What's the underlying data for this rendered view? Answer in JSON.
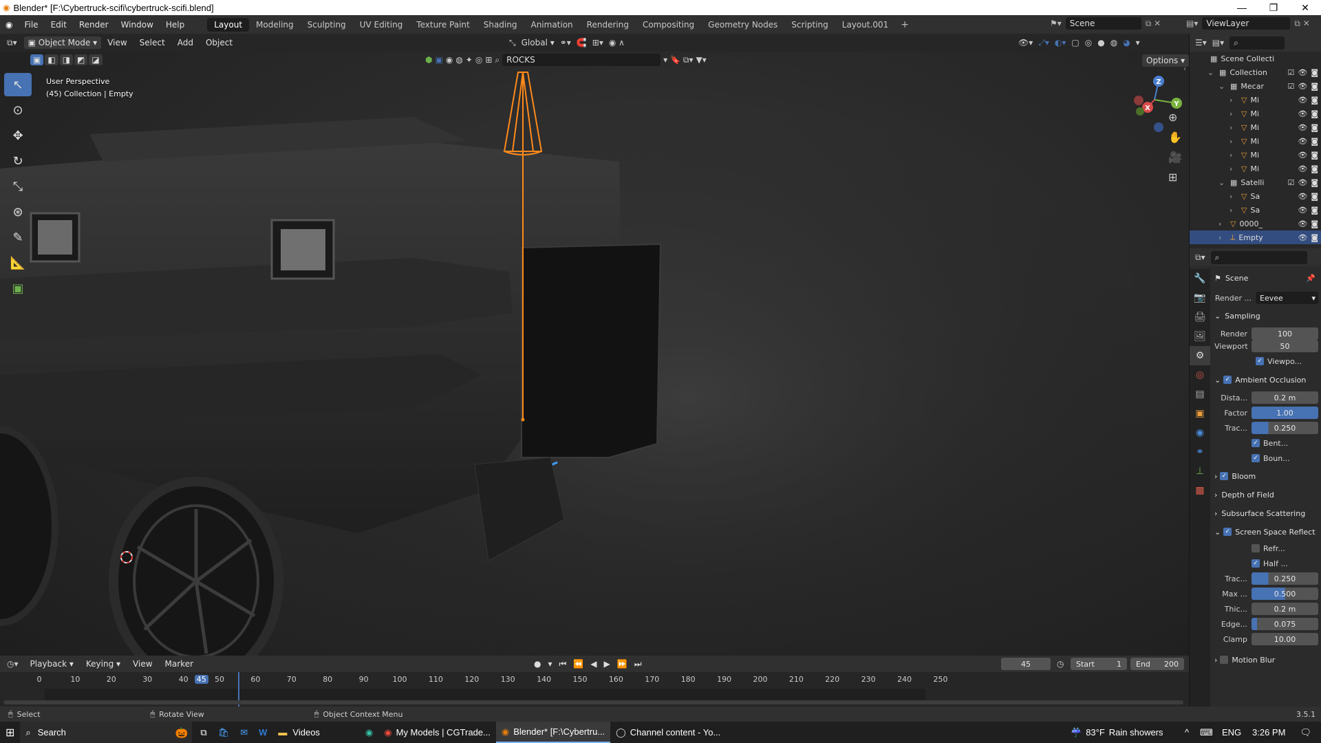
{
  "window": {
    "title": "Blender* [F:\\Cybertruck-scifi\\cybertruck-scifi.blend]"
  },
  "menu": [
    "File",
    "Edit",
    "Render",
    "Window",
    "Help"
  ],
  "workspaces": [
    "Layout",
    "Modeling",
    "Sculpting",
    "UV Editing",
    "Texture Paint",
    "Shading",
    "Animation",
    "Rendering",
    "Compositing",
    "Geometry Nodes",
    "Scripting",
    "Layout.001"
  ],
  "active_workspace": "Layout",
  "scene": {
    "label": "Scene",
    "view_layer": "ViewLayer"
  },
  "viewport_header": {
    "mode": "Object Mode",
    "menus": [
      "View",
      "Select",
      "Add",
      "Object"
    ],
    "orientation": "Global",
    "collection_filter": "ROCKS",
    "options": "Options"
  },
  "viewport": {
    "overlay_line1": "User Perspective",
    "overlay_line2": "(45) Collection | Empty"
  },
  "gizmo": {
    "x": "X",
    "y": "Y",
    "z": "Z"
  },
  "outliner": {
    "root": "Scene Collecti",
    "rows": [
      {
        "label": "Collection",
        "indent": 1,
        "type": "collection"
      },
      {
        "label": "Mecar",
        "indent": 2,
        "type": "collection"
      },
      {
        "label": "Mi",
        "indent": 3,
        "type": "mesh"
      },
      {
        "label": "Mi",
        "indent": 3,
        "type": "mesh"
      },
      {
        "label": "Mi",
        "indent": 3,
        "type": "mesh"
      },
      {
        "label": "Mi",
        "indent": 3,
        "type": "mesh"
      },
      {
        "label": "Mi",
        "indent": 3,
        "type": "mesh"
      },
      {
        "label": "Mi",
        "indent": 3,
        "type": "mesh"
      },
      {
        "label": "Satelli",
        "indent": 2,
        "type": "collection"
      },
      {
        "label": "Sa",
        "indent": 3,
        "type": "mesh"
      },
      {
        "label": "Sa",
        "indent": 3,
        "type": "mesh"
      },
      {
        "label": "0000_",
        "indent": 2,
        "type": "mesh"
      },
      {
        "label": "Empty",
        "indent": 2,
        "type": "empty",
        "selected": true
      }
    ]
  },
  "properties": {
    "context": "Scene",
    "render_engine_label": "Render ...",
    "render_engine": "Eevee",
    "sampling": {
      "title": "Sampling",
      "render_label": "Render",
      "render": "100",
      "viewport_label": "Viewport",
      "viewport": "50",
      "denoise": "Viewpo..."
    },
    "ao": {
      "title": "Ambient Occlusion",
      "distance_label": "Dista...",
      "distance": "0.2 m",
      "factor_label": "Factor",
      "factor": "1.00",
      "trace_label": "Trac...",
      "trace": "0.250",
      "bent": "Bent...",
      "bounce": "Boun..."
    },
    "bloom": "Bloom",
    "dof": "Depth of Field",
    "sss": "Subsurface Scattering",
    "ssr": {
      "title": "Screen Space Reflect",
      "refraction": "Refr...",
      "half": "Half ...",
      "trace_label": "Trac...",
      "trace": "0.250",
      "max_label": "Max ...",
      "max": "0.500",
      "thick_label": "Thic...",
      "thick": "0.2 m",
      "edge_label": "Edge...",
      "edge": "0.075",
      "clamp_label": "Clamp",
      "clamp": "10.00"
    },
    "motion_blur": "Motion Blur"
  },
  "timeline": {
    "menus": [
      "Playback",
      "Keying",
      "View",
      "Marker"
    ],
    "current_frame": "45",
    "start_label": "Start",
    "start": "1",
    "end_label": "End",
    "end": "200",
    "ticks": [
      "0",
      "10",
      "20",
      "30",
      "40",
      "45",
      "50",
      "60",
      "70",
      "80",
      "90",
      "100",
      "110",
      "120",
      "130",
      "140",
      "150",
      "160",
      "170",
      "180",
      "190",
      "200",
      "210",
      "220",
      "230",
      "240",
      "250"
    ]
  },
  "statusbar": {
    "select": "Select",
    "rotate": "Rotate View",
    "context": "Object Context Menu",
    "version": "3.5.1"
  },
  "taskbar": {
    "search": "Search",
    "apps": [
      {
        "label": "Videos",
        "active": false
      },
      {
        "label": "My Models | CGTrade...",
        "active": false
      },
      {
        "label": "Blender* [F:\\Cybertru...",
        "active": true
      },
      {
        "label": "Channel content - Yo...",
        "active": false
      }
    ],
    "weather_temp": "83°F",
    "weather": "Rain showers",
    "lang": "ENG",
    "time": "3:26 PM"
  },
  "colors": {
    "accent": "#4772b3",
    "selected_outline": "#ff8a1a",
    "emission": "#3aa0ff"
  }
}
